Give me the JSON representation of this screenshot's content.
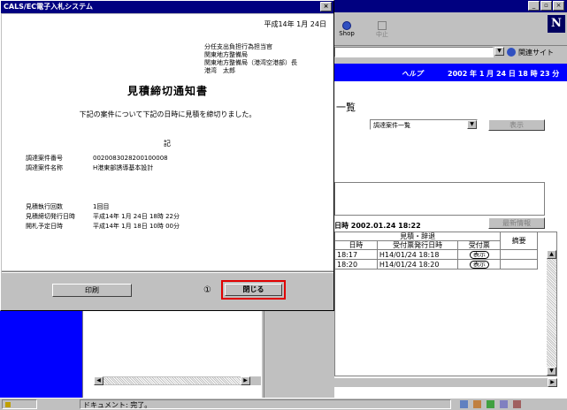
{
  "browser": {
    "window_controls": [
      "_",
      "▫",
      "×"
    ],
    "toolbar": {
      "shop_label": "Shop",
      "stop_label": "中止"
    },
    "related_sites_label": "関連サイト",
    "status_text": "ドキュメント: 完了。"
  },
  "app": {
    "help_label": "ヘルプ",
    "datetime": "2002 年 1 月 24 日 18 時 23 分",
    "page_title_partial": "一覧",
    "select_value": "調達案件一覧",
    "display_button": "表示",
    "timestamp_label": "日時 2002.01.24 18:22",
    "detail_button": "最新情報",
    "table": {
      "group_header": "見積・辞退",
      "col1_header": "日時",
      "col2_header": "受付票発行日時",
      "col3_header": "受付票",
      "col4_header": "摘要",
      "rows": [
        {
          "c1": "18:17",
          "c2": "H14/01/24 18:18",
          "c3": "表示"
        },
        {
          "c1": "18:20",
          "c2": "H14/01/24 18:20",
          "c3": "表示"
        }
      ]
    }
  },
  "dialog": {
    "title": "CALS/EC電子入札システム",
    "date": "平成14年 1月 24日",
    "addressees": [
      "分任支出負担行為担当官",
      "関東地方整備局",
      "関東地方整備局（港湾空港部）長",
      "港湾　太郎"
    ],
    "heading": "見積締切通知書",
    "body_text": "下記の案件について下記の日時に見積を締切りました。",
    "ki": "記",
    "fields_a": [
      {
        "label": "調達案件番号",
        "value": "0020083028200100008"
      },
      {
        "label": "調達案件名称",
        "value": "H港東部誘導基本設計"
      }
    ],
    "fields_b": [
      {
        "label": "見積執行回数",
        "value": "1回目"
      },
      {
        "label": "見積締切発行日時",
        "value": "平成14年 1月 24日 18時 22分"
      },
      {
        "label": "開札予定日時",
        "value": "平成14年 1月 18日 10時 00分"
      }
    ],
    "print_button": "印刷",
    "marker": "①",
    "close_button": "閉じる"
  }
}
